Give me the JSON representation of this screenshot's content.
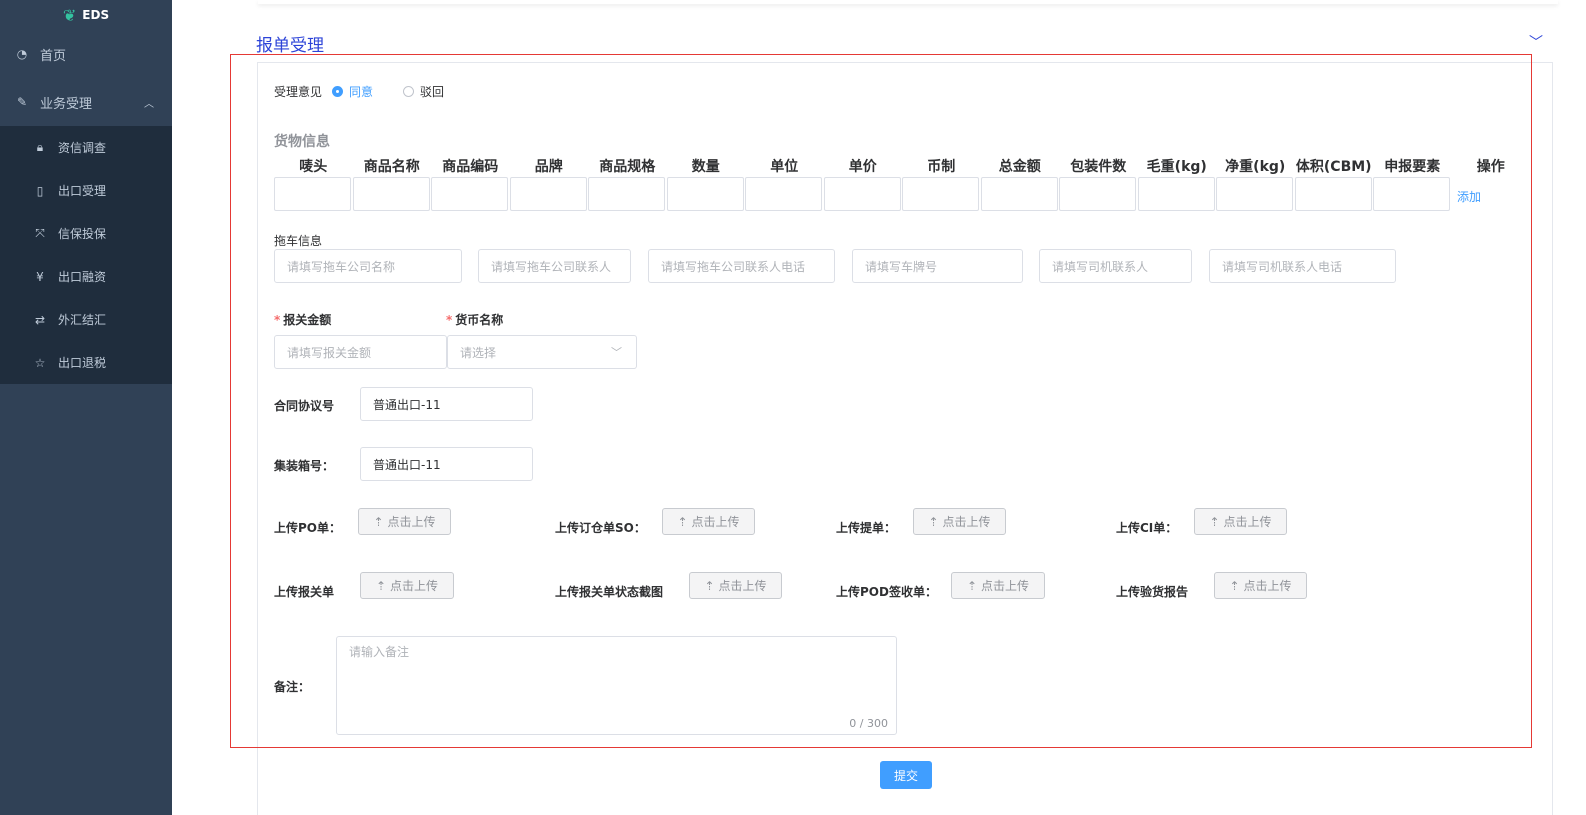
{
  "app": {
    "logo_text": "EDS"
  },
  "sidebar": {
    "items": [
      {
        "label": "首页",
        "icon": "dashboard-icon"
      },
      {
        "label": "业务受理",
        "icon": "edit-icon"
      }
    ],
    "submenu": [
      {
        "label": "资信调查",
        "icon": "lock-icon"
      },
      {
        "label": "出口受理",
        "icon": "book-icon"
      },
      {
        "label": "信保投保",
        "icon": "fullscreen-icon"
      },
      {
        "label": "出口融资",
        "icon": "money-icon"
      },
      {
        "label": "外汇结汇",
        "icon": "exchange-icon"
      },
      {
        "label": "出口退税",
        "icon": "star-icon"
      }
    ]
  },
  "section": {
    "title": "报单受理"
  },
  "opinion": {
    "label": "受理意见",
    "agree": "同意",
    "reject": "驳回"
  },
  "goods": {
    "title": "货物信息",
    "columns": [
      "唛头",
      "商品名称",
      "商品编码",
      "品牌",
      "商品规格",
      "数量",
      "单位",
      "单价",
      "币制",
      "总金额",
      "包装件数",
      "毛重(kg)",
      "净重(kg)",
      "体积(CBM)",
      "申报要素",
      "操作"
    ],
    "add_label": "添加"
  },
  "truck": {
    "label": "拖车信息",
    "placeholders": [
      "请填写拖车公司名称",
      "请填写拖车公司联系人",
      "请填写拖车公司联系人电话",
      "请填写车牌号",
      "请填写司机联系人",
      "请填写司机联系人电话"
    ]
  },
  "customs": {
    "amount_label": "报关金额",
    "amount_placeholder": "请填写报关金额",
    "currency_label": "货币名称",
    "currency_placeholder": "请选择"
  },
  "contract": {
    "label": "合同协议号",
    "value": "普通出口-11"
  },
  "container": {
    "label": "集装箱号：",
    "value": "普通出口-11"
  },
  "uploads": {
    "button_label": "点击上传",
    "row1": [
      "上传PO单：",
      "上传订仓单SO：",
      "上传提单：",
      "上传CI单："
    ],
    "row2": [
      "上传报关单",
      "上传报关单状态截图",
      "上传POD签收单：",
      "上传验货报告"
    ]
  },
  "remark": {
    "label": "备注：",
    "placeholder": "请输入备注",
    "counter": "0 / 300"
  },
  "submit_label": "提交",
  "colors": {
    "primary": "#409eff",
    "sidebar": "#304156",
    "title": "#2d44d8",
    "highlight": "#e53935"
  }
}
